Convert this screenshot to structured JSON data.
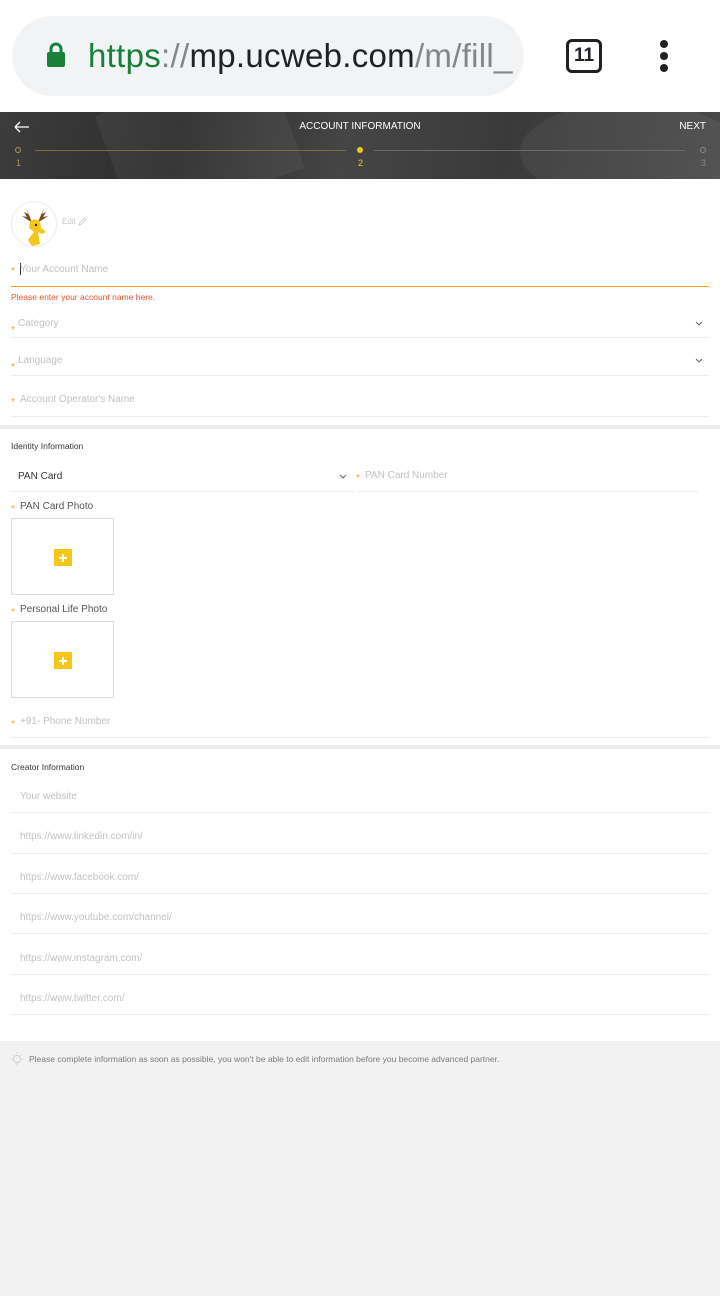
{
  "browser": {
    "url_scheme": "https",
    "url_sep": "://",
    "url_host": "mp.ucweb.com",
    "url_path": "/m/fill_",
    "tab_count": "11",
    "icons": [
      "lock-icon",
      "tab-switcher-icon",
      "more-vert-icon"
    ]
  },
  "header": {
    "title": "ACCOUNT INFORMATION",
    "next_label": "NEXT",
    "steps": [
      {
        "label": "1",
        "state": "inactive"
      },
      {
        "label": "2",
        "state": "active"
      },
      {
        "label": "3",
        "state": "inactive"
      }
    ],
    "accent_color": "#f5c518"
  },
  "account": {
    "edit_label": "Edit",
    "account_name_placeholder": "Your Account Name",
    "account_name_error": "Please enter your account name here.",
    "category_placeholder": "Category",
    "language_placeholder": "Language",
    "operator_name_placeholder": "Account Operator's Name"
  },
  "identity": {
    "section_title": "Identity Information",
    "id_type_value": "PAN Card",
    "pan_number_placeholder": "PAN Card Number",
    "pan_photo_label": "PAN Card Photo",
    "life_photo_label": "Personal Life Photo",
    "phone_placeholder": "+91- Phone Number"
  },
  "creator": {
    "section_title": "Creator Information",
    "website_placeholder": "Your website",
    "linkedin_placeholder": "https://www.linkedin.com/in/",
    "facebook_placeholder": "https://www.facebook.com/",
    "youtube_placeholder": "https://www.youtube.com/channel/",
    "instagram_placeholder": "https://www.instagram.com/",
    "twitter_placeholder": "https://www.twitter.com/"
  },
  "notice": {
    "text": "Please complete information as soon as possible, you won't be able to edit information before you become advanced partner."
  },
  "colors": {
    "required_star": "#f5a623",
    "error_text": "#e8542f",
    "focus_underline": "#f5a623",
    "url_scheme": "#188038"
  }
}
